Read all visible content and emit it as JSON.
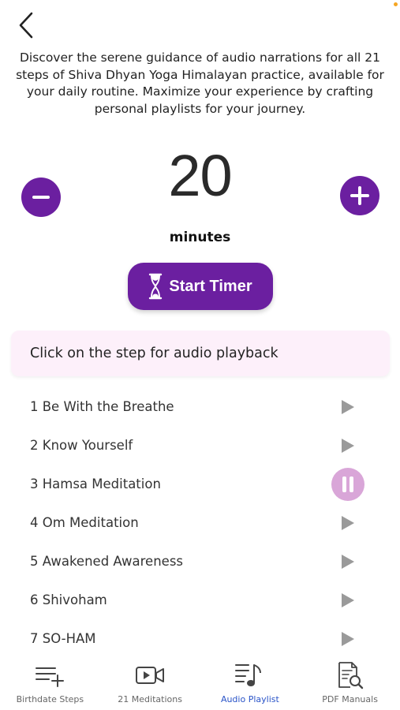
{
  "header": {
    "back_icon": "chevron-left-icon"
  },
  "intro_text": "Discover the serene guidance of audio narrations for all 21 steps of Shiva Dhyan Yoga Himalayan practice, available for your daily routine. Maximize your experience by crafting personal playlists for your journey.",
  "timer": {
    "value": "20",
    "unit_label": "minutes",
    "start_label": "Start Timer",
    "minus_icon": "minus-icon",
    "plus_icon": "plus-icon",
    "start_icon": "hourglass-icon"
  },
  "hint": "Click on the step for audio playback",
  "steps": [
    {
      "label": "1 Be With the Breathe",
      "state": "play"
    },
    {
      "label": "2 Know Yourself",
      "state": "play"
    },
    {
      "label": "3 Hamsa Meditation",
      "state": "pause"
    },
    {
      "label": "4 Om Meditation",
      "state": "play"
    },
    {
      "label": "5 Awakened Awareness",
      "state": "play"
    },
    {
      "label": "6 Shivoham",
      "state": "play"
    },
    {
      "label": "7 SO-HAM",
      "state": "play"
    }
  ],
  "bottom_nav": [
    {
      "label": "Birthdate Steps",
      "icon": "playlist-add-icon",
      "active": false
    },
    {
      "label": "21 Meditations",
      "icon": "video-icon",
      "active": false
    },
    {
      "label": "Audio Playlist",
      "icon": "music-list-icon",
      "active": true
    },
    {
      "label": "PDF Manuals",
      "icon": "document-search-icon",
      "active": false
    }
  ],
  "colors": {
    "primary": "#6b1fa0",
    "active_nav": "#2a54c8",
    "hint_bg": "#fdf0fa",
    "pause_bg": "#d9a6d8"
  }
}
